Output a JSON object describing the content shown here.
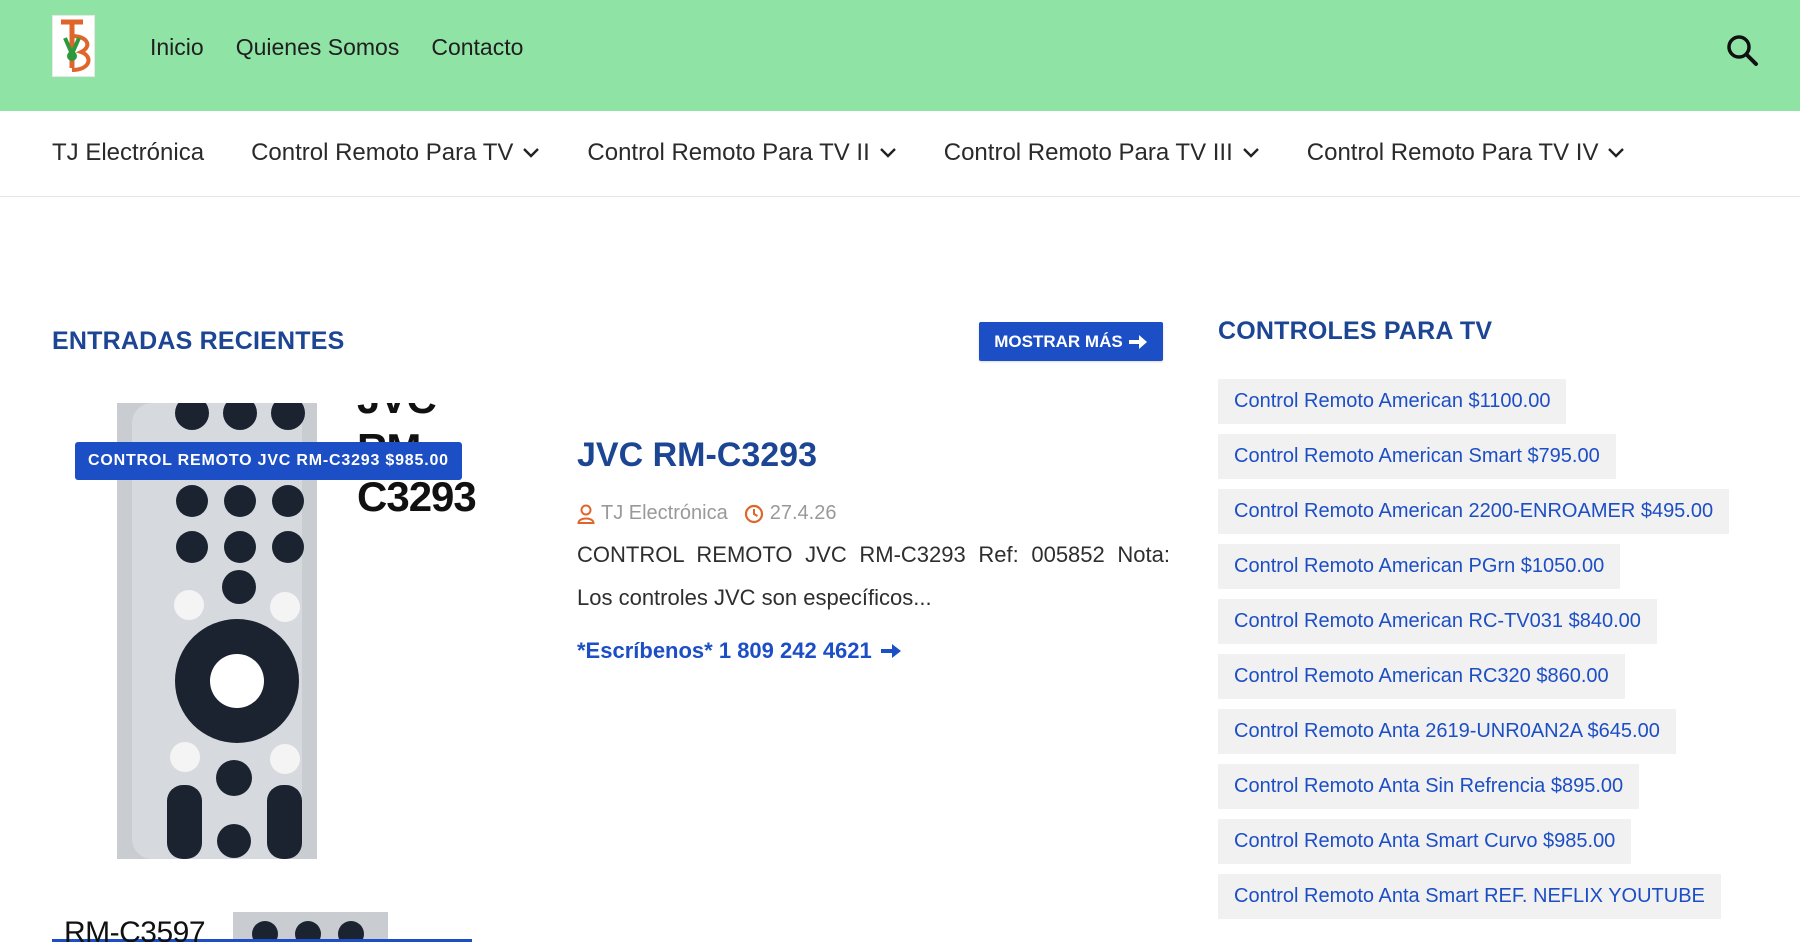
{
  "top_nav": {
    "items": [
      "Inicio",
      "Quienes Somos",
      "Contacto"
    ]
  },
  "sub_nav": {
    "items": [
      {
        "label": "TJ Electrónica",
        "has_dropdown": false
      },
      {
        "label": "Control Remoto Para TV",
        "has_dropdown": true
      },
      {
        "label": "Control Remoto Para TV II",
        "has_dropdown": true
      },
      {
        "label": "Control Remoto Para TV III",
        "has_dropdown": true
      },
      {
        "label": "Control Remoto Para TV IV",
        "has_dropdown": true
      }
    ]
  },
  "recent": {
    "title": "ENTRADAS RECIENTES",
    "more_label": "MOSTRAR MÁS"
  },
  "post": {
    "thumb_text_top": "JVC",
    "thumb_text_model": "RM-C3293",
    "badge": "CONTROL REMOTO JVC RM-C3293 $985.00",
    "title": "JVC RM-C3293",
    "author": "TJ Electrónica",
    "date": "27.4.26",
    "excerpt": "CONTROL REMOTO JVC RM-C3293 Ref: 005852 Nota: Los controles JVC son específicos...",
    "link": "*Escríbenos* 1 809 242 4621"
  },
  "post2": {
    "thumb_text": "RM-C3597"
  },
  "sidebar": {
    "title": "CONTROLES PARA TV",
    "tags": [
      "Control Remoto American $1100.00",
      "Control Remoto American Smart $795.00",
      "Control Remoto American 2200-ENROAMER $495.00",
      "Control Remoto American PGrn $1050.00",
      "Control Remoto American RC-TV031 $840.00",
      "Control Remoto American RC320 $860.00",
      "Control Remoto Anta 2619-UNR0AN2A $645.00",
      "Control Remoto Anta Sin Refrencia $895.00",
      "Control Remoto Anta Smart Curvo $985.00",
      "Control Remoto Anta Smart REF. NEFLIX YOUTUBE"
    ]
  },
  "colors": {
    "topbar": "#8fe3a5",
    "accent": "#1c4ec5",
    "heading": "#1c4594",
    "tag_bg": "#f1f1f1"
  }
}
